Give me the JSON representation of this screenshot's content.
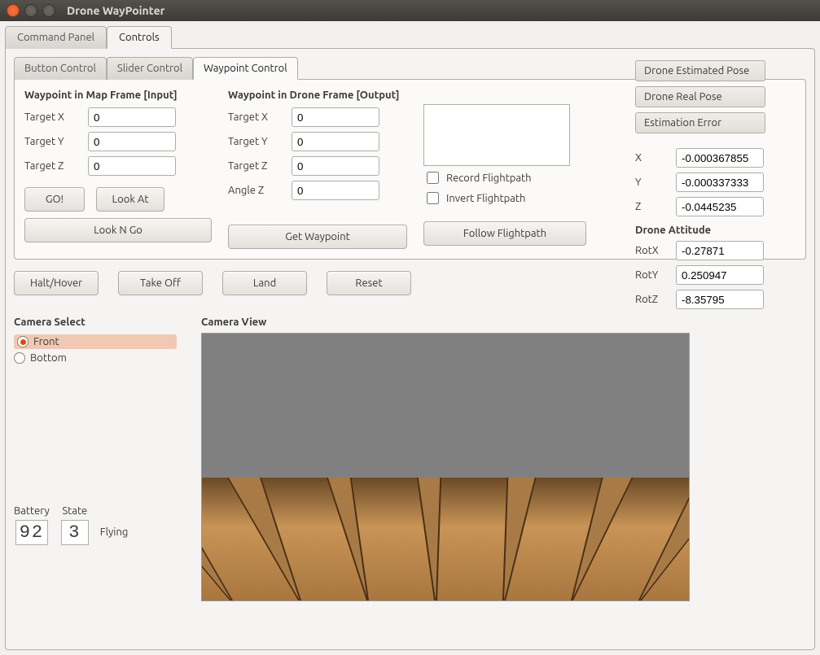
{
  "window": {
    "title": "Drone WayPointer"
  },
  "tabs": {
    "command_panel": "Command Panel",
    "controls": "Controls"
  },
  "inner_tabs": {
    "button": "Button Control",
    "slider": "Slider Control",
    "waypoint": "Waypoint Control"
  },
  "map_frame": {
    "title": "Waypoint in Map Frame [Input]",
    "target_x_label": "Target X",
    "target_x": "0",
    "target_y_label": "Target Y",
    "target_y": "0",
    "target_z_label": "Target Z",
    "target_z": "0",
    "go": "GO!",
    "look_at": "Look At",
    "look_n_go": "Look N Go"
  },
  "drone_frame": {
    "title": "Waypoint in Drone Frame [Output]",
    "target_x_label": "Target X",
    "target_x": "0",
    "target_y_label": "Target Y",
    "target_y": "0",
    "target_z_label": "Target Z",
    "target_z": "0",
    "angle_z_label": "Angle Z",
    "angle_z": "0",
    "get_waypoint": "Get Waypoint"
  },
  "flightpath": {
    "record_label": "Record Flightpath",
    "invert_label": "Invert Flightpath",
    "follow": "Follow Flightpath"
  },
  "actions": {
    "halt": "Halt/Hover",
    "takeoff": "Take Off",
    "land": "Land",
    "reset": "Reset"
  },
  "sidebar": {
    "est_pose": "Drone Estimated Pose",
    "real_pose": "Drone Real Pose",
    "error": "Estimation Error",
    "x_label": "X",
    "x": "-0.000367855",
    "y_label": "Y",
    "y": "-0.000337333",
    "z_label": "Z",
    "z": "-0.0445235",
    "attitude_title": "Drone Attitude",
    "rotx_label": "RotX",
    "rotx": "-0.27871",
    "roty_label": "RotY",
    "roty": "0.250947",
    "rotz_label": "RotZ",
    "rotz": "-8.35795"
  },
  "camera": {
    "select_title": "Camera Select",
    "front": "Front",
    "bottom": "Bottom",
    "view_title": "Camera View"
  },
  "status": {
    "battery_label": "Battery",
    "battery": "92",
    "state_label": "State",
    "state_num": "3",
    "state_text": "Flying"
  }
}
